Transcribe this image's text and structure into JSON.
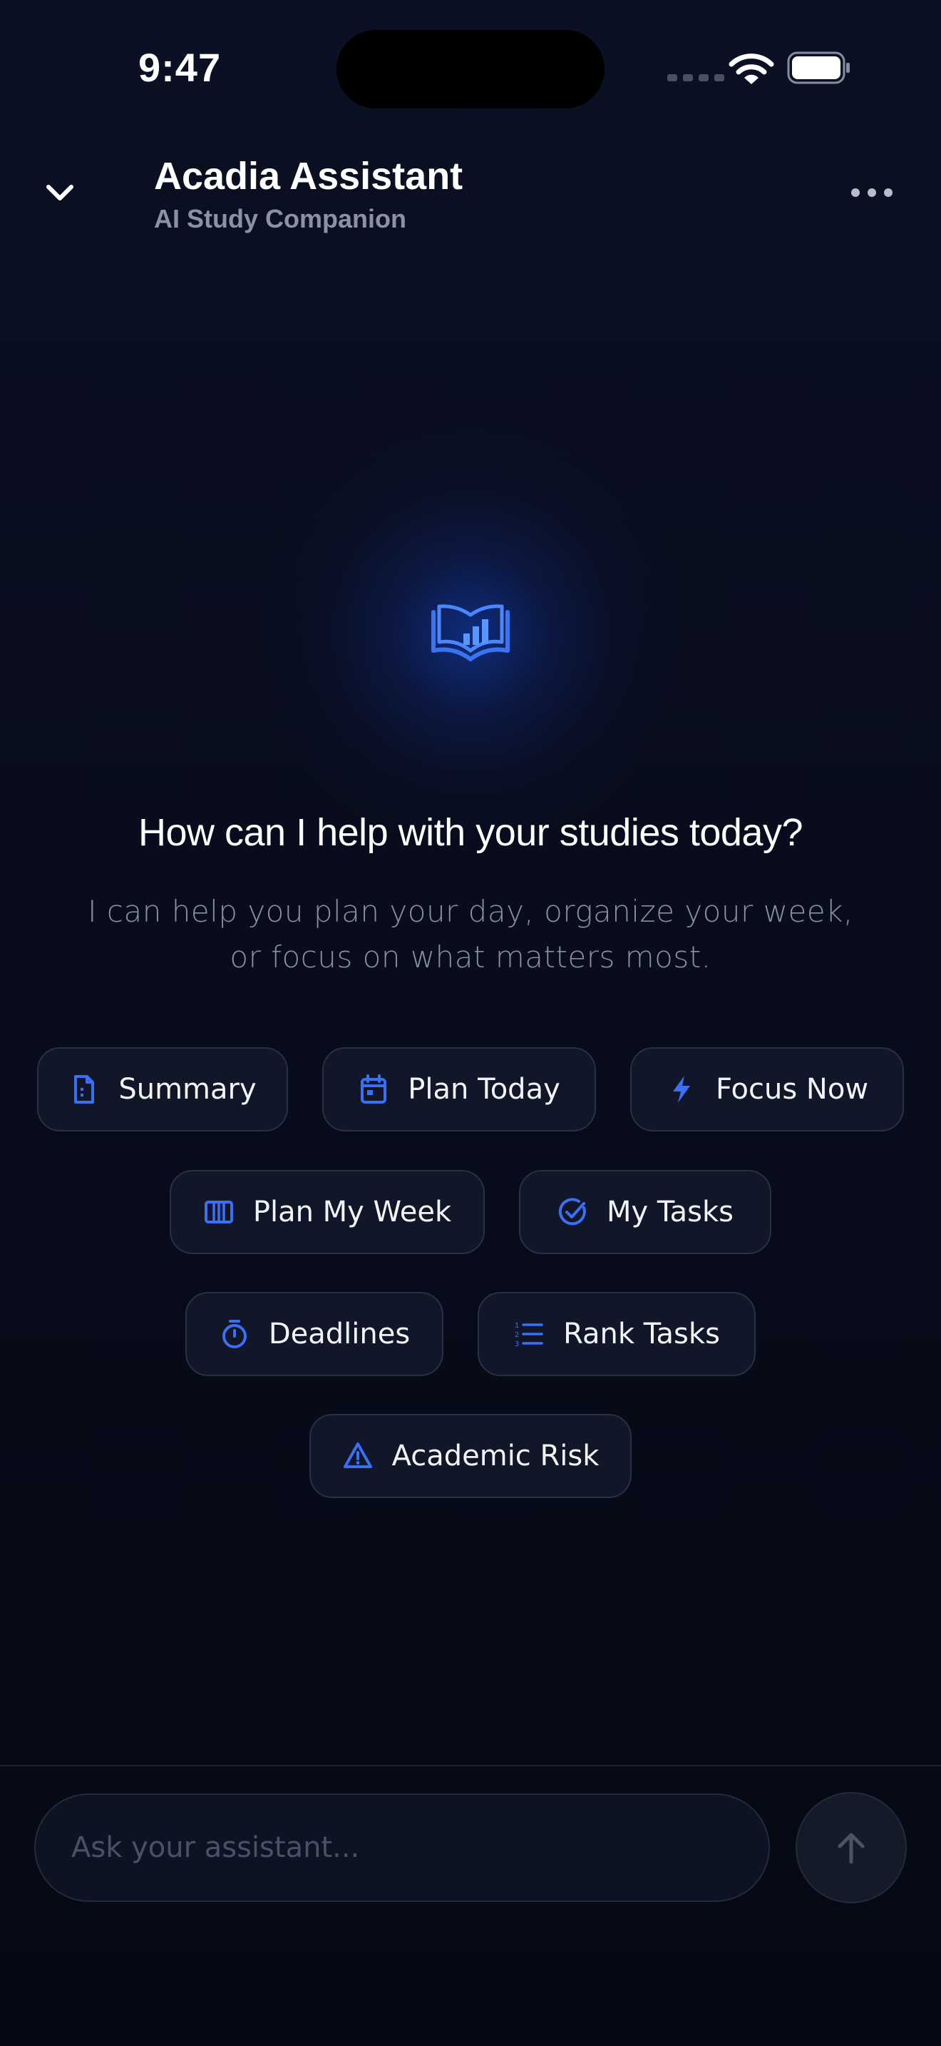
{
  "status_bar": {
    "time": "9:47"
  },
  "header": {
    "title": "Acadia Assistant",
    "subtitle": "AI Study Companion"
  },
  "hero": {
    "icon": "book-chart-icon",
    "headline": "How can I help with your studies today?",
    "description_line1": "I can help you plan your day, organize your week,",
    "description_line2": "or focus on what matters most."
  },
  "chips": [
    {
      "label": "Summary",
      "icon": "document-icon"
    },
    {
      "label": "Plan Today",
      "icon": "calendar-icon"
    },
    {
      "label": "Focus Now",
      "icon": "lightning-icon"
    },
    {
      "label": "Plan My Week",
      "icon": "week-columns-icon"
    },
    {
      "label": "My Tasks",
      "icon": "check-circle-icon"
    },
    {
      "label": "Deadlines",
      "icon": "stopwatch-icon"
    },
    {
      "label": "Rank Tasks",
      "icon": "numbered-list-icon"
    },
    {
      "label": "Academic Risk",
      "icon": "warning-triangle-icon"
    }
  ],
  "composer": {
    "placeholder": "Ask your assistant...",
    "value": ""
  },
  "colors": {
    "accent": "#3b6ff5",
    "background": "#080c1c",
    "chip_background": "#111729",
    "chip_border": "#2a3043",
    "muted_text": "#8a8fa3"
  }
}
